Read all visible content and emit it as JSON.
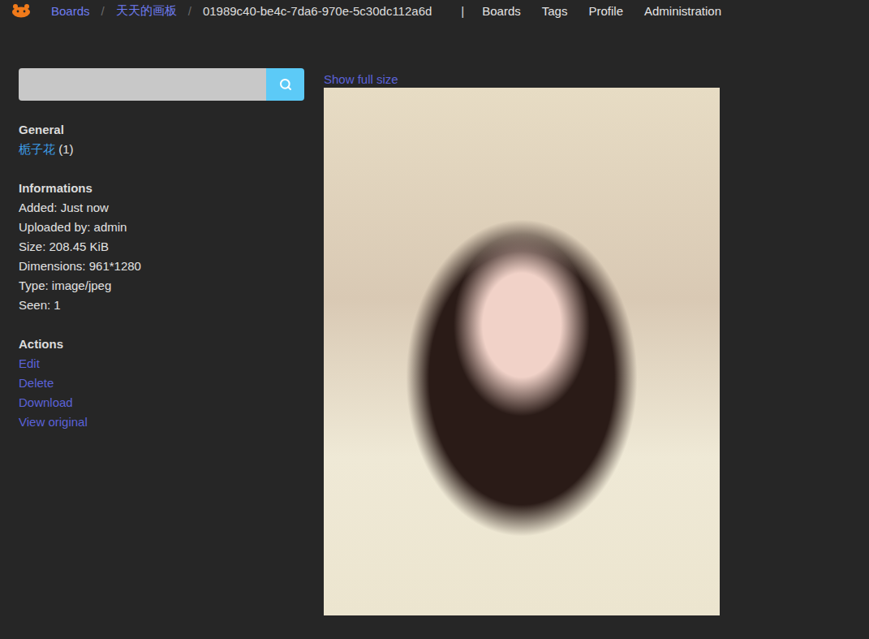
{
  "nav": {
    "breadcrumbs": [
      {
        "label": "Boards",
        "current": false
      },
      {
        "label": "天天的画板",
        "current": false
      },
      {
        "label": "01989c40-be4c-7da6-970e-5c30dc112a6d",
        "current": true
      }
    ],
    "separator": "/",
    "divider": "|",
    "links": [
      "Boards",
      "Tags",
      "Profile",
      "Administration"
    ]
  },
  "sidebar": {
    "sections": [
      {
        "title": "General",
        "kind": "tags",
        "items": [
          {
            "label": "栀子花",
            "count": "(1)"
          }
        ]
      },
      {
        "title": "Informations",
        "kind": "info",
        "items": [
          "Added: Just now",
          "Uploaded by: admin",
          "Size: 208.45 KiB",
          "Dimensions: 961*1280",
          "Type: image/jpeg",
          "Seen: 1"
        ]
      },
      {
        "title": "Actions",
        "kind": "links",
        "items": [
          "Edit",
          "Delete",
          "Download",
          "View original"
        ]
      }
    ]
  },
  "viewer": {
    "link": "Show full size"
  }
}
